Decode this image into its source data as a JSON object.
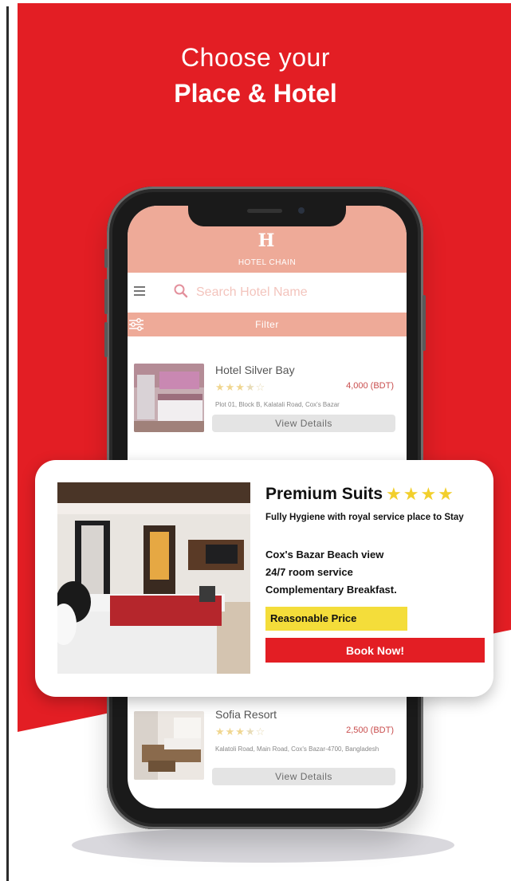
{
  "headline": {
    "line1": "Choose your",
    "line2": "Place & Hotel"
  },
  "colors": {
    "brand_red": "#e31e24",
    "header_salmon": "#eeaa98",
    "star_yellow": "#f2cf2c",
    "price_yellow": "#f4dd3a"
  },
  "app": {
    "logo": "H",
    "brand": "HOTEL CHAIN",
    "search": {
      "placeholder": "Search Hotel Name"
    },
    "filter_label": "Filter",
    "hotels": [
      {
        "name": "Hotel Silver Bay",
        "rating": 3.5,
        "price": "4,000 (BDT)",
        "address": "Plot 01, Block B, Kalatali Road, Cox's Bazar",
        "button": "View Details"
      },
      {
        "name": "Sofia Resort",
        "rating": 3.5,
        "price": "2,500 (BDT)",
        "address": "Kalatoli Road, Main Road, Cox's Bazar-4700, Bangladesh",
        "button": "View Details"
      }
    ]
  },
  "promo": {
    "title": "Premium Suits",
    "stars": 4,
    "subtitle": "Fully Hygiene with royal service  place to Stay",
    "features": [
      "Cox's Bazar Beach view",
      "24/7 room service",
      "Complementary Breakfast."
    ],
    "price_label": "Reasonable Price",
    "cta": "Book Now!"
  }
}
